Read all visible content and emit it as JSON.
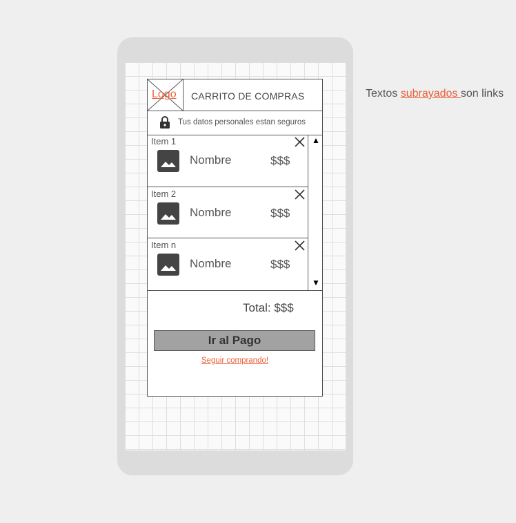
{
  "header": {
    "logo": "Logo",
    "title": "CARRITO DE COMPRAS"
  },
  "security": {
    "text": "Tus datos personales estan seguros",
    "icon": "lock-icon"
  },
  "items": [
    {
      "label": "Item 1",
      "name": "Nombre",
      "price": "$$$"
    },
    {
      "label": "Item 2",
      "name": "Nombre",
      "price": "$$$"
    },
    {
      "label": "Item n",
      "name": "Nombre",
      "price": "$$$"
    }
  ],
  "scroll": {
    "up": "▲",
    "down": "▼"
  },
  "footer": {
    "total": "Total: $$$",
    "pay_button": "Ir al Pago",
    "continue_link": "Seguir comprando!"
  },
  "note": {
    "before": "Textos ",
    "link": "subrayados ",
    "after": "son links"
  },
  "colors": {
    "link": "#e8613a",
    "button": "#a2a2a2",
    "border": "#555555"
  }
}
